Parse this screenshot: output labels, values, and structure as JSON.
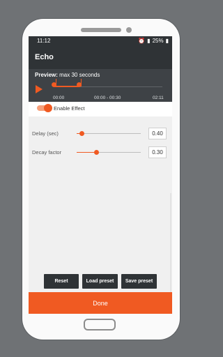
{
  "status_bar": {
    "time": "11:12",
    "battery": "25%"
  },
  "app_bar": {
    "title": "Echo"
  },
  "preview": {
    "label_bold": "Preview:",
    "label_rest": " max 30 seconds",
    "start_time": "00:00",
    "range": "00:00 - 00:30",
    "end_time": "02:11"
  },
  "toggle": {
    "label": "Enable Effect",
    "checked": true
  },
  "settings": [
    {
      "label": "Delay (sec)",
      "value": "0.40",
      "level": 0.08
    },
    {
      "label": "Decay factor",
      "value": "0.30",
      "level": 0.3
    }
  ],
  "buttons": {
    "reset": "Reset",
    "load": "Load preset",
    "save": "Save preset"
  },
  "done_label": "Done",
  "colors": {
    "accent": "#f05a22",
    "dark": "#2f3336"
  }
}
